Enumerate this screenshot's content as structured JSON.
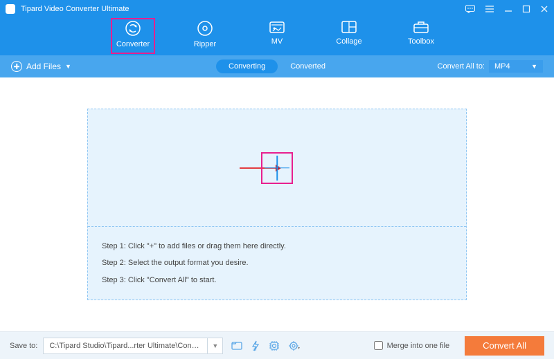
{
  "titlebar": {
    "app_title": "Tipard Video Converter Ultimate"
  },
  "nav": {
    "items": [
      {
        "label": "Converter"
      },
      {
        "label": "Ripper"
      },
      {
        "label": "MV"
      },
      {
        "label": "Collage"
      },
      {
        "label": "Toolbox"
      }
    ]
  },
  "subbar": {
    "add_files": "Add Files",
    "tab_converting": "Converting",
    "tab_converted": "Converted",
    "convert_all_to": "Convert All to:",
    "format": "MP4"
  },
  "dropzone": {
    "step1": "Step 1: Click \"+\" to add files or drag them here directly.",
    "step2": "Step 2: Select the output format you desire.",
    "step3": "Step 3: Click \"Convert All\" to start."
  },
  "footer": {
    "save_to_label": "Save to:",
    "path": "C:\\Tipard Studio\\Tipard...rter Ultimate\\Converted",
    "merge_label": "Merge into one file",
    "convert_all": "Convert All"
  }
}
